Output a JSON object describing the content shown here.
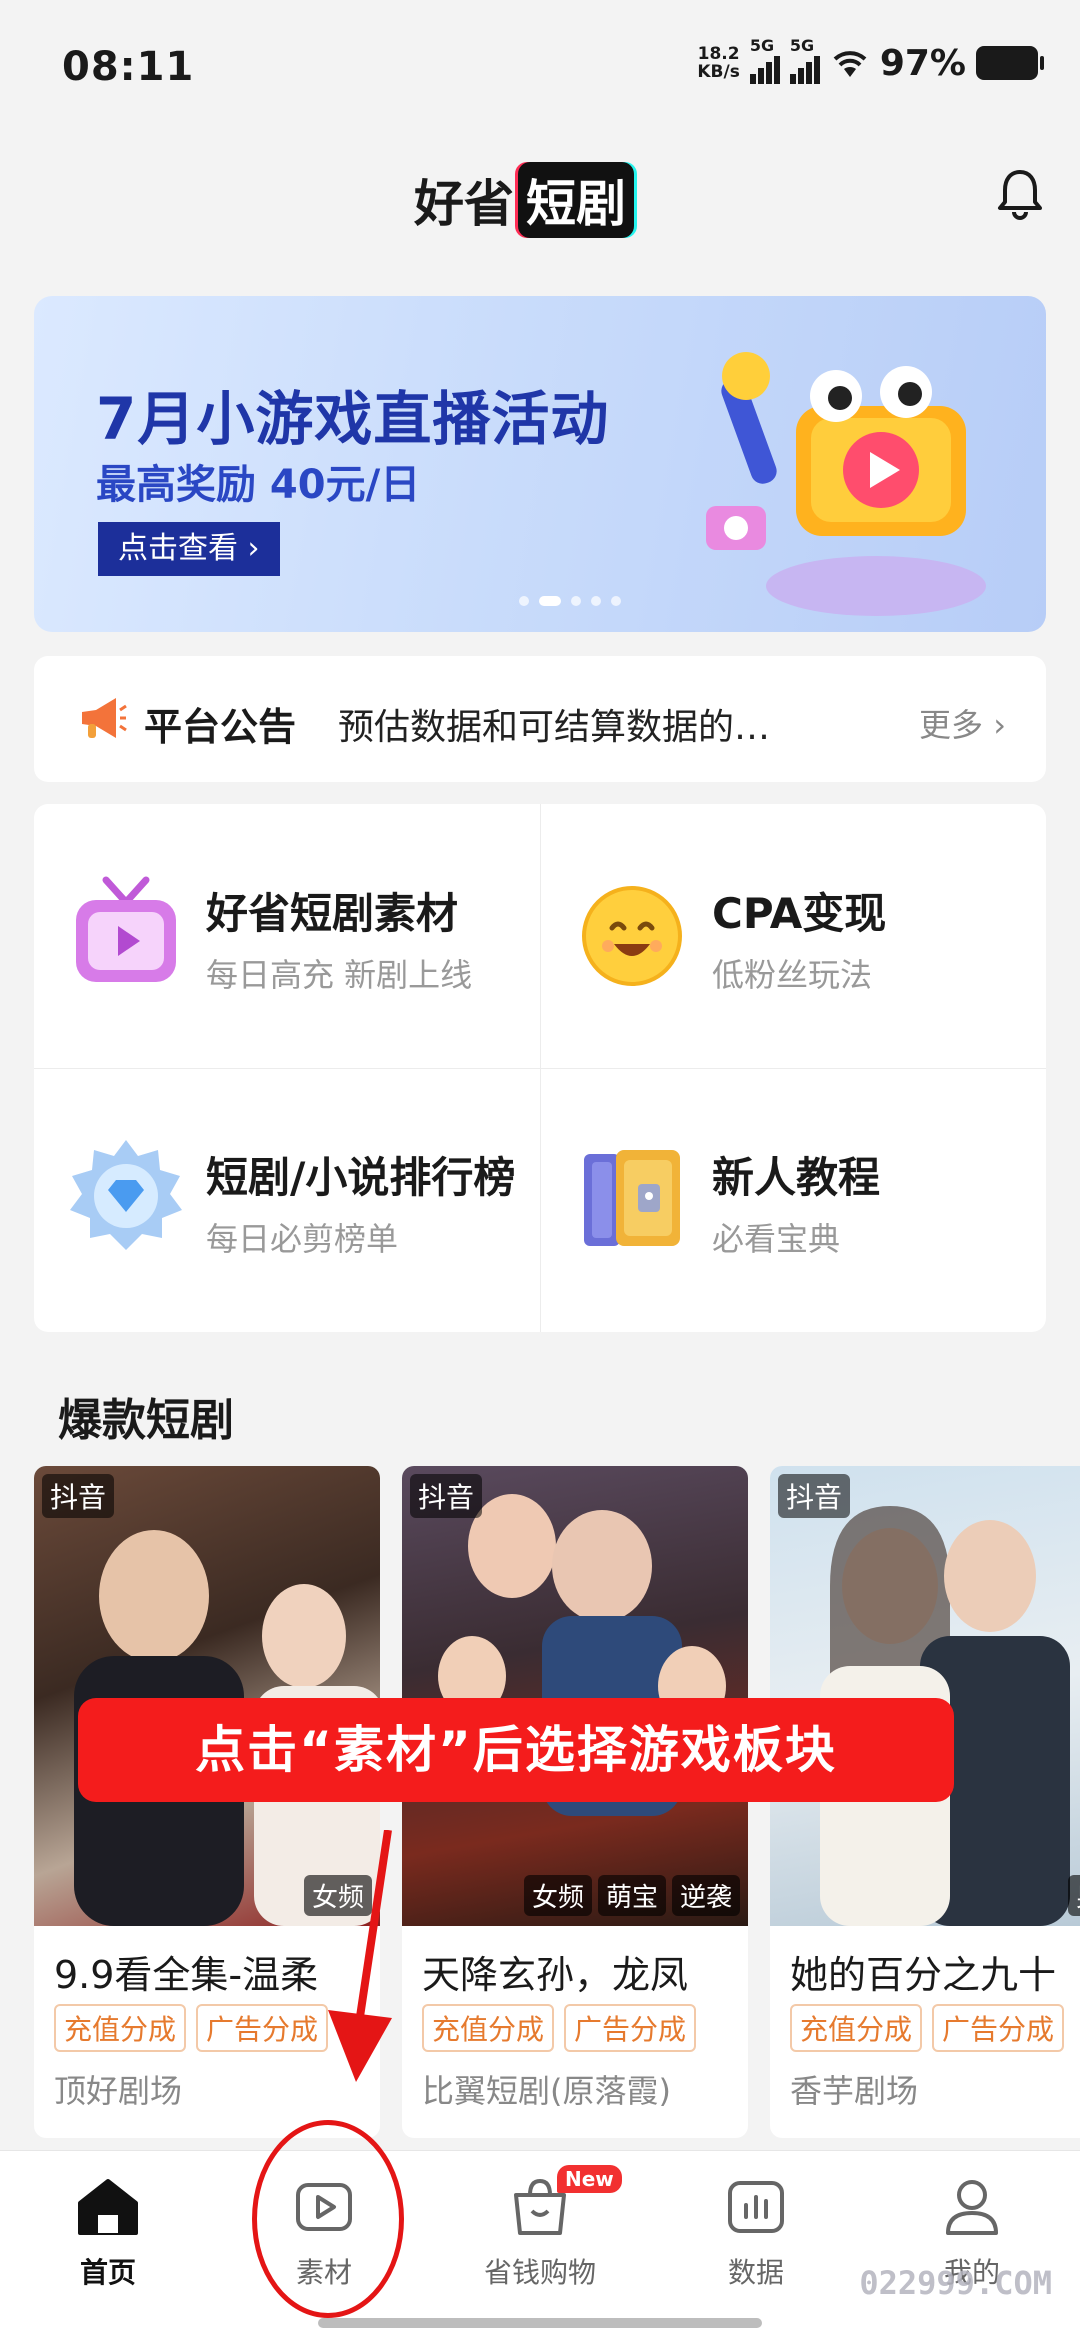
{
  "status": {
    "time": "08:11",
    "speed_top": "18.2",
    "speed_unit": "KB/s",
    "net1": "5G",
    "net2": "5G",
    "battery": "97%"
  },
  "header": {
    "logo_text": "好省",
    "logo_tag": "短剧"
  },
  "banner": {
    "title": "7月小游戏直播活动",
    "subtitle": "最高奖励 40元/日",
    "button": "点击查看 ›"
  },
  "notice": {
    "title": "平台公告",
    "text": "预估数据和可结算数据的…",
    "more": "更多 ›"
  },
  "grid": [
    {
      "title": "好省短剧素材",
      "subtitle": "每日高充 新剧上线",
      "icon": "tv-icon"
    },
    {
      "title": "CPA变现",
      "subtitle": "低粉丝玩法",
      "icon": "smiley-icon"
    },
    {
      "title": "短剧/小说排行榜",
      "subtitle": "每日必剪榜单",
      "icon": "medal-icon"
    },
    {
      "title": "新人教程",
      "subtitle": "必看宝典",
      "icon": "book-icon"
    }
  ],
  "section_title": "爆款短剧",
  "cards": [
    {
      "platform": "抖音",
      "tags": [
        "女频"
      ],
      "title": "9.9看全集-温柔",
      "chips": [
        "充值分成",
        "广告分成"
      ],
      "studio": "顶好剧场"
    },
    {
      "platform": "抖音",
      "tags": [
        "女频",
        "萌宝",
        "逆袭"
      ],
      "title": "天降玄孙，龙凤",
      "chips": [
        "充值分成",
        "广告分成"
      ],
      "studio": "比翼短剧(原落霞)"
    },
    {
      "platform": "抖音",
      "tags": [
        "男频"
      ],
      "title": "她的百分之九十",
      "chips": [
        "充值分成",
        "广告分成"
      ],
      "studio": "香芋剧场"
    }
  ],
  "callout": "点击“素材”后选择游戏板块",
  "tabbar": [
    {
      "label": "首页",
      "icon": "home-icon",
      "active": true
    },
    {
      "label": "素材",
      "icon": "play-icon",
      "active": false
    },
    {
      "label": "省钱购物",
      "icon": "bag-icon",
      "active": false,
      "badge": "New"
    },
    {
      "label": "数据",
      "icon": "chart-icon",
      "active": false
    },
    {
      "label": "我的",
      "icon": "user-icon",
      "active": false
    }
  ],
  "watermark": "022999.COM",
  "colors": {
    "accent": "#f41c1c",
    "banner_text": "#1f36a8",
    "chip": "#e67a2e"
  }
}
